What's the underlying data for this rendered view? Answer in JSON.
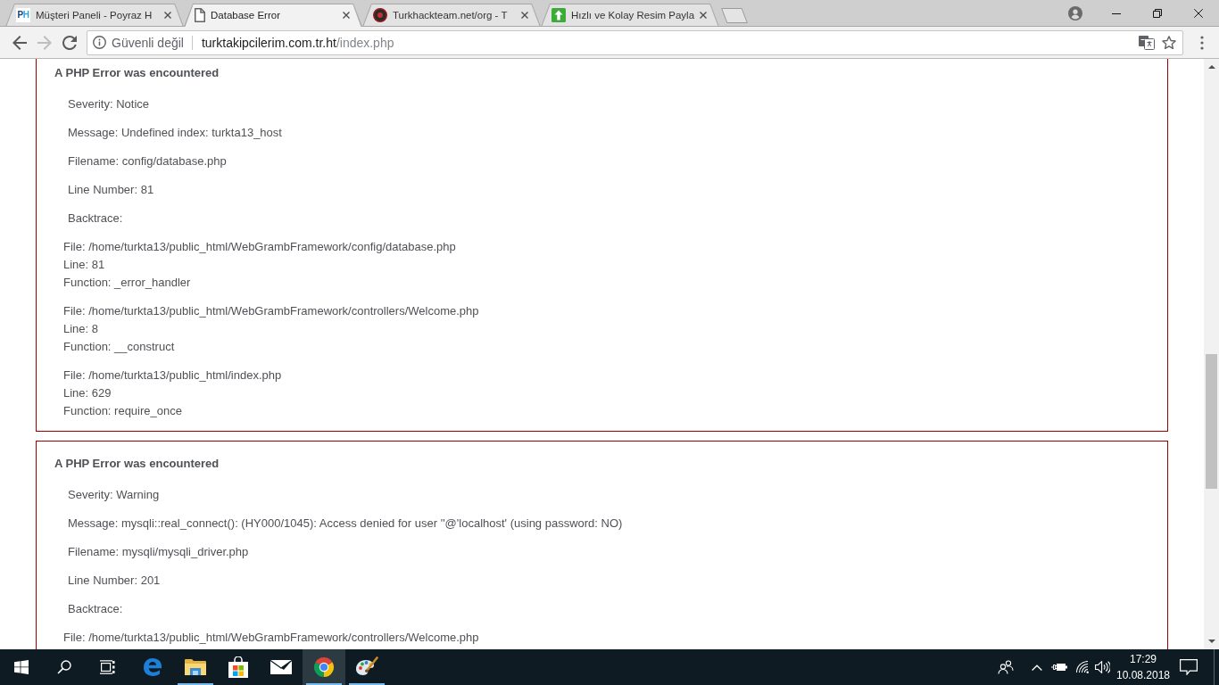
{
  "tabs": [
    {
      "title": "Müşteri Paneli - Poyraz H",
      "favicon": {
        "kind": "text",
        "text": "PH"
      },
      "selected": false
    },
    {
      "title": "Database Error",
      "favicon": {
        "kind": "document"
      },
      "selected": true
    },
    {
      "title": "Turkhackteam.net/org - T",
      "favicon": {
        "kind": "round-logo"
      },
      "selected": false
    },
    {
      "title": "Hızlı ve Kolay Resim Payla",
      "favicon": {
        "kind": "up-arrow"
      },
      "selected": false
    }
  ],
  "toolbar": {
    "navigation": [
      {
        "kind": "back",
        "disabled": false
      },
      {
        "kind": "forward",
        "disabled": true
      },
      {
        "kind": "reload",
        "disabled": false
      }
    ],
    "address_bar": {
      "security": "Güvenli değil",
      "host": "turktakipcilerim.com.tr.ht",
      "path": "/index.php"
    }
  },
  "page": {
    "errors": [
      {
        "heading": "A PHP Error was encountered",
        "details": [
          "Severity: Notice",
          "Message: Undefined index: turkta13_host",
          "Filename: config/database.php",
          "Line Number: 81",
          "Backtrace:"
        ],
        "backtrace": [
          {
            "lines": [
              "File: /home/turkta13/public_html/WebGrambFramework/config/database.php",
              "Line: 81",
              "Function: _error_handler"
            ]
          },
          {
            "lines": [
              "File: /home/turkta13/public_html/WebGrambFramework/controllers/Welcome.php",
              "Line: 8",
              "Function: __construct"
            ]
          },
          {
            "lines": [
              "File: /home/turkta13/public_html/index.php",
              "Line: 629",
              "Function: require_once"
            ]
          }
        ]
      },
      {
        "heading": "A PHP Error was encountered",
        "details": [
          "Severity: Warning",
          "Message: mysqli::real_connect(): (HY000/1045): Access denied for user ''@'localhost' (using password: NO)",
          "Filename: mysqli/mysqli_driver.php",
          "Line Number: 201",
          "Backtrace:"
        ],
        "backtrace": [
          {
            "lines": [
              "File: /home/turkta13/public_html/WebGrambFramework/controllers/Welcome.php"
            ]
          }
        ]
      }
    ]
  },
  "taskbar": {
    "apps": [
      {
        "kind": "edge",
        "running": false,
        "active": false
      },
      {
        "kind": "explorer",
        "running": true,
        "active": false
      },
      {
        "kind": "store",
        "running": false,
        "active": false
      },
      {
        "kind": "mail",
        "running": false,
        "active": false
      },
      {
        "kind": "chrome",
        "running": true,
        "active": true
      },
      {
        "kind": "paint",
        "running": true,
        "active": false
      }
    ],
    "clock": {
      "time": "17:29",
      "date": "10.08.2018"
    }
  }
}
